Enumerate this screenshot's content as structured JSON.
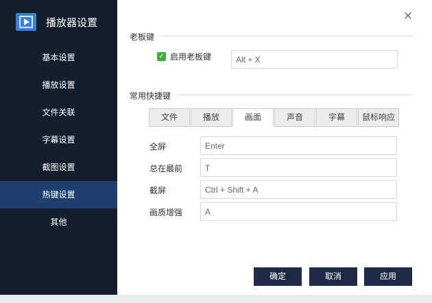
{
  "app": {
    "title": "播放器设置",
    "logo_icon": "video-player-icon"
  },
  "sidebar": {
    "items": [
      {
        "label": "基本设置"
      },
      {
        "label": "播放设置"
      },
      {
        "label": "文件关联"
      },
      {
        "label": "字幕设置"
      },
      {
        "label": "截图设置"
      },
      {
        "label": "热键设置",
        "active": true
      },
      {
        "label": "其他"
      }
    ]
  },
  "boss_key": {
    "section_title": "老板键",
    "checkbox_label": "启用老板键",
    "checked": true,
    "value": "Alt + X"
  },
  "shortcuts": {
    "section_title": "常用快捷键",
    "tabs": [
      {
        "label": "文件"
      },
      {
        "label": "播放"
      },
      {
        "label": "画面",
        "active": true
      },
      {
        "label": "声音"
      },
      {
        "label": "字幕"
      },
      {
        "label": "鼠标响应"
      }
    ],
    "rows": [
      {
        "label": "全屏",
        "value": "Enter"
      },
      {
        "label": "总在最前",
        "value": "T"
      },
      {
        "label": "截屏",
        "value": "Ctrl + Shift + A"
      },
      {
        "label": "画质增强",
        "value": "A"
      }
    ]
  },
  "buttons": {
    "ok": "确定",
    "cancel": "取消",
    "apply": "应用"
  },
  "close_icon": "×",
  "colors": {
    "sidebar_bg": "#151e2d",
    "sidebar_active": "#1f3f6e",
    "button_bg": "#1d2b47",
    "check_green": "#3cae3a"
  }
}
